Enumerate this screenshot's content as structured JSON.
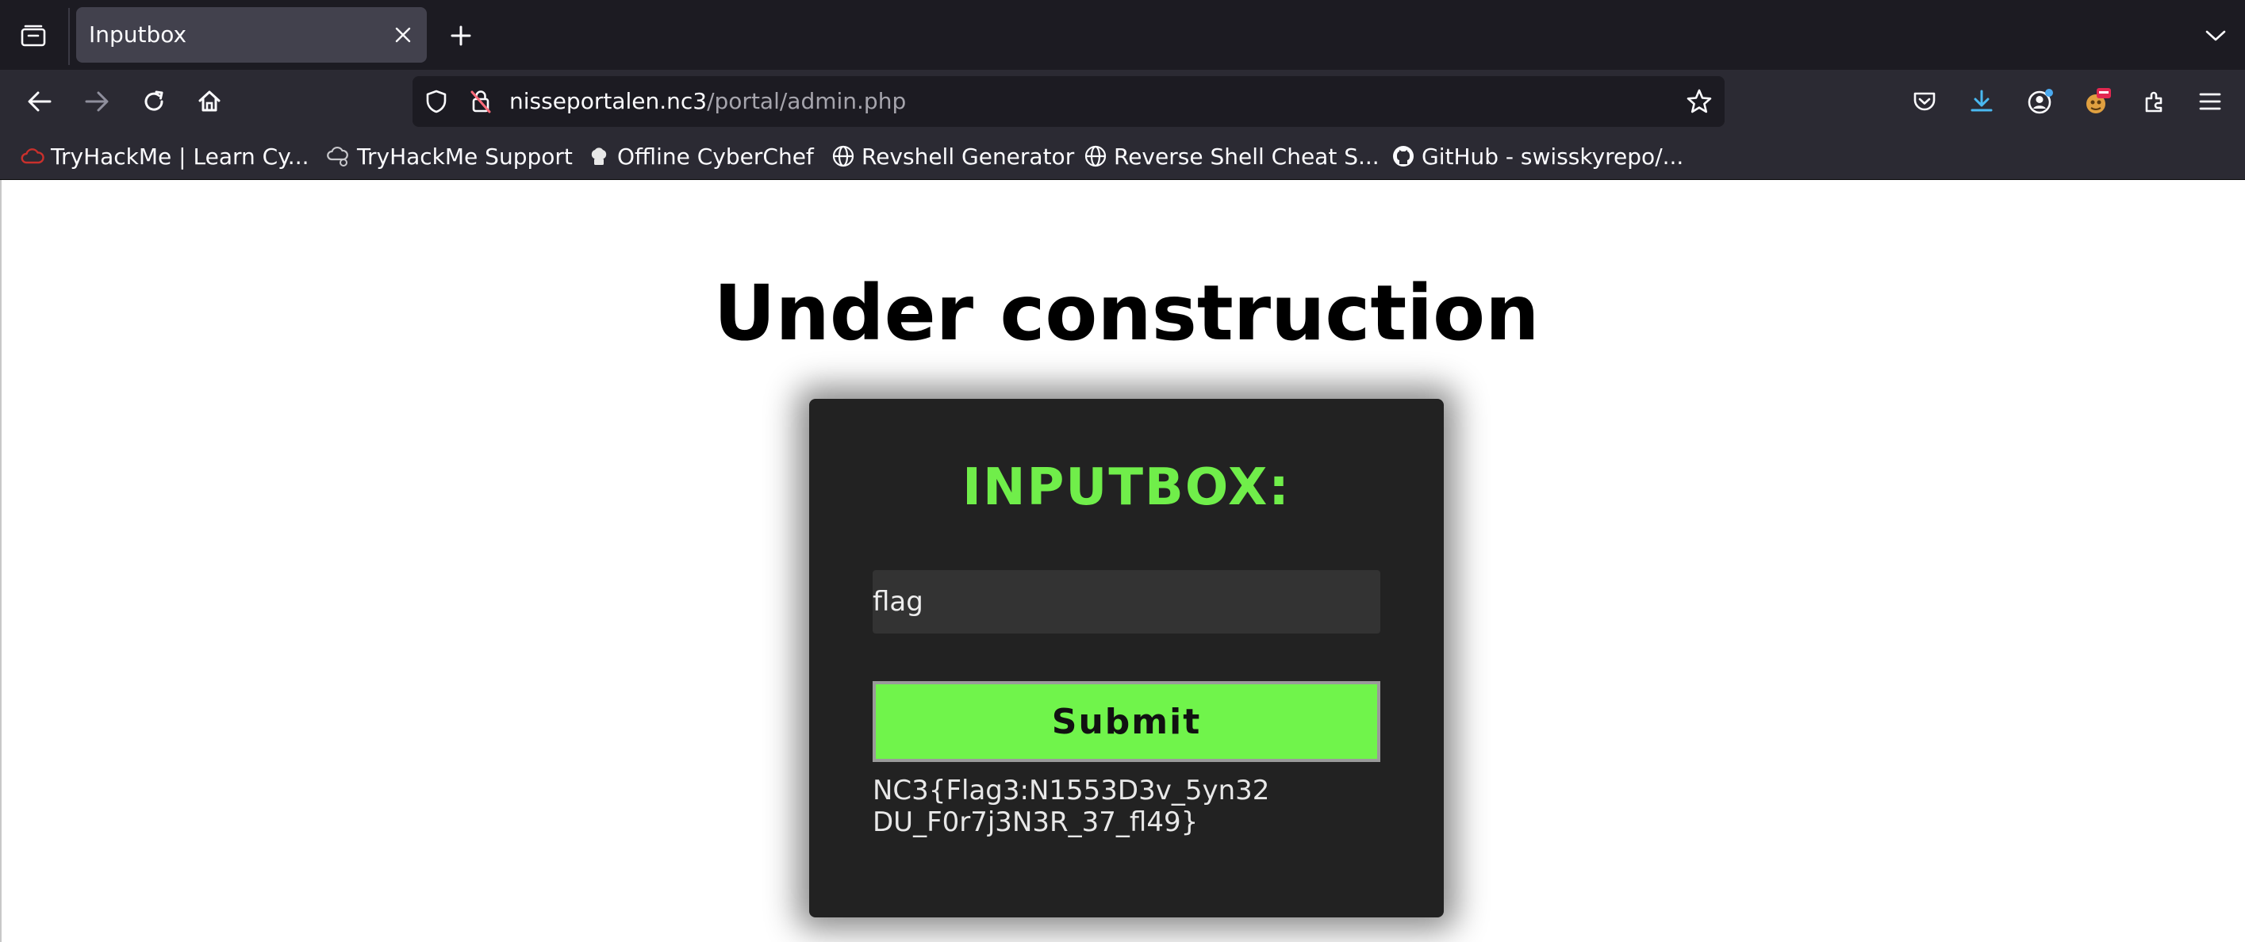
{
  "browser": {
    "tab": {
      "title": "Inputbox"
    },
    "address": {
      "host": "nisseportalen.nc3",
      "path": "/portal/admin.php"
    },
    "bookmarks": [
      {
        "label": "TryHackMe | Learn Cy...",
        "icon": "tryhackme-icon"
      },
      {
        "label": "TryHackMe Support",
        "icon": "cloud-support-icon"
      },
      {
        "label": "Offline CyberChef",
        "icon": "chef-icon"
      },
      {
        "label": "Revshell Generator",
        "icon": "globe-icon"
      },
      {
        "label": "Reverse Shell Cheat S...",
        "icon": "globe-icon"
      },
      {
        "label": "GitHub - swisskyrepo/...",
        "icon": "github-icon"
      }
    ]
  },
  "page": {
    "heading": "Under construction",
    "card": {
      "title": "INPUTBOX:",
      "input_value": "flag",
      "submit_label": "Submit",
      "result_line1": "NC3{Flag3:N1553D3v_5yn32",
      "result_line2": "DU_F0r7j3N3R_37_fl49}"
    },
    "colors": {
      "accent_green": "#70ee4a",
      "card_bg": "#222222"
    }
  }
}
